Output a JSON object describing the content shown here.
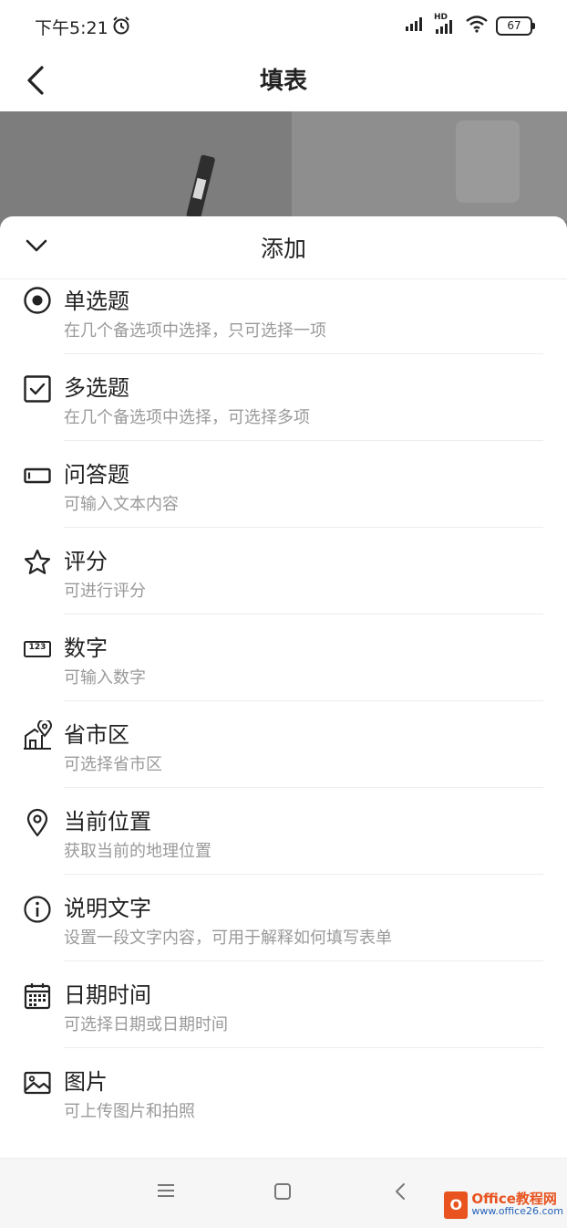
{
  "status_bar": {
    "time": "下午5:21",
    "network_label": "HD",
    "battery": "67"
  },
  "nav": {
    "title": "填表"
  },
  "sheet": {
    "title": "添加",
    "items": [
      {
        "icon": "radio-icon",
        "title": "单选题",
        "desc": "在几个备选项中选择，只可选择一项"
      },
      {
        "icon": "checkbox-icon",
        "title": "多选题",
        "desc": "在几个备选项中选择，可选择多项"
      },
      {
        "icon": "text-field-icon",
        "title": "问答题",
        "desc": "可输入文本内容"
      },
      {
        "icon": "star-icon",
        "title": "评分",
        "desc": "可进行评分"
      },
      {
        "icon": "number-icon",
        "title": "数字",
        "desc": "可输入数字"
      },
      {
        "icon": "building-location-icon",
        "title": "省市区",
        "desc": "可选择省市区"
      },
      {
        "icon": "location-pin-icon",
        "title": "当前位置",
        "desc": "获取当前的地理位置"
      },
      {
        "icon": "info-icon",
        "title": "说明文字",
        "desc": "设置一段文字内容，可用于解释如何填写表单"
      },
      {
        "icon": "calendar-icon",
        "title": "日期时间",
        "desc": "可选择日期或日期时间"
      },
      {
        "icon": "image-icon",
        "title": "图片",
        "desc": "可上传图片和拍照"
      }
    ]
  },
  "number_icon_text": "123",
  "watermark": {
    "logo": "O",
    "main": "Office教程网",
    "sub": "www.office26.com"
  }
}
